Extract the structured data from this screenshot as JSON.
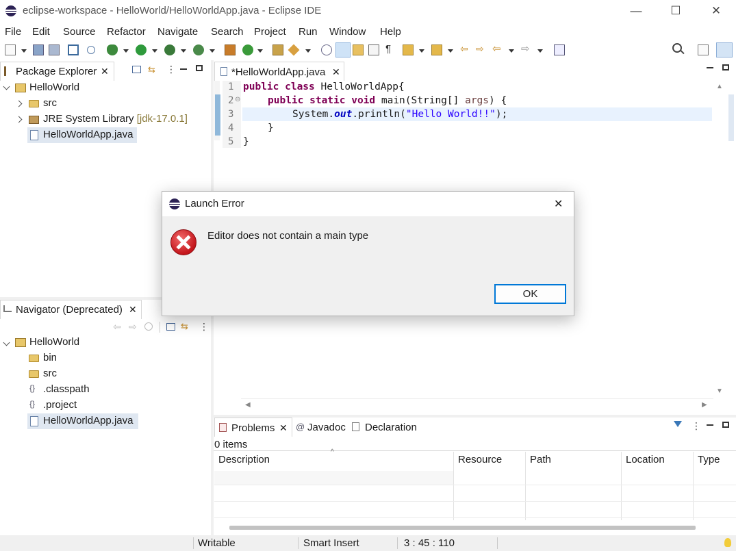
{
  "window": {
    "title": "eclipse-workspace - HelloWorld/HelloWorldApp.java - Eclipse IDE",
    "minimize": "—",
    "maximize": "☐",
    "close": "✕"
  },
  "menu": [
    "File",
    "Edit",
    "Source",
    "Refactor",
    "Navigate",
    "Search",
    "Project",
    "Run",
    "Window",
    "Help"
  ],
  "package_explorer": {
    "tab_label": "Package Explorer",
    "tree": {
      "project": "HelloWorld",
      "src": "src",
      "jre": "JRE System Library",
      "jre_version": "[jdk-17.0.1]",
      "file": "HelloWorldApp.java"
    }
  },
  "navigator": {
    "tab_label": "Navigator (Deprecated)",
    "tree": {
      "project": "HelloWorld",
      "items": [
        "bin",
        "src",
        ".classpath",
        ".project",
        "HelloWorldApp.java"
      ]
    }
  },
  "editor": {
    "tab_label": "*HelloWorldApp.java",
    "line_numbers": [
      "1",
      "2",
      "3",
      "4",
      "5"
    ],
    "lines": {
      "l1_kw": "public class",
      "l1_rest": " HelloWorldApp{",
      "l2_kw": "public static void",
      "l2_rest": " main(String[] ",
      "l2_param": "args",
      "l2_end": ") {",
      "l3_a": "System.",
      "l3_fld": "out",
      "l3_b": ".println(",
      "l3_str": "\"Hello World!!\"",
      "l3_c": ");",
      "l4": "}",
      "l5": "}"
    }
  },
  "dialog": {
    "title": "Launch Error",
    "message": "Editor does not contain a main type",
    "ok_label": "OK",
    "close": "✕"
  },
  "bottom_tabs": {
    "problems": "Problems",
    "javadoc": "Javadoc",
    "declaration": "Declaration"
  },
  "problems": {
    "count": "0 items",
    "columns": [
      "Description",
      "Resource",
      "Path",
      "Location",
      "Type"
    ]
  },
  "statusbar": {
    "writable": "Writable",
    "insert_mode": "Smart Insert",
    "position": "3 : 45 : 110"
  },
  "colors": {
    "accent": "#0078d7",
    "keyword": "#7f0055",
    "string": "#2a00ff",
    "field": "#0000c0",
    "current_line": "#e8f2fe"
  }
}
